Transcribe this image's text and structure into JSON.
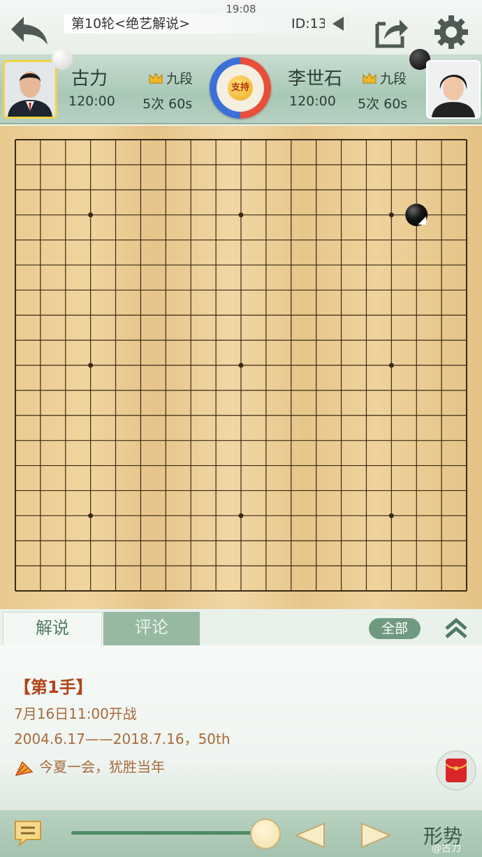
{
  "status_bar": {
    "time": "19:08"
  },
  "header": {
    "title": "第10轮<绝艺解说>",
    "id_label": "ID:13",
    "icons": {
      "back": "back-arrow-icon",
      "dropdown": "triangle-left-icon",
      "share": "share-icon",
      "settings": "gear-icon"
    }
  },
  "players": {
    "left": {
      "name": "古力",
      "rank": "九段",
      "time": "120:00",
      "byoyomi": "5次 60s",
      "stone": "white"
    },
    "right": {
      "name": "李世石",
      "rank": "九段",
      "time": "120:00",
      "byoyomi": "5次 60s",
      "stone": "black"
    },
    "support_label": "支持"
  },
  "board": {
    "size": 19,
    "stones": [
      {
        "color": "black",
        "col": 17,
        "row": 4,
        "last_move": true
      }
    ],
    "star_points": [
      [
        4,
        4
      ],
      [
        10,
        4
      ],
      [
        16,
        4
      ],
      [
        4,
        10
      ],
      [
        10,
        10
      ],
      [
        16,
        10
      ],
      [
        4,
        16
      ],
      [
        10,
        16
      ],
      [
        16,
        16
      ]
    ]
  },
  "tabs": {
    "commentary": "解说",
    "comments": "评论",
    "filter_all": "全部"
  },
  "commentary": {
    "move_label": "【第1手】",
    "lines": [
      "7月16日11:00开战",
      "2004.6.17——2018.7.16，50th",
      "今夏一会，犹胜当年"
    ]
  },
  "bottom_bar": {
    "trend_label": "形势",
    "slider_position": 0.95
  },
  "watermark": "@古力"
}
